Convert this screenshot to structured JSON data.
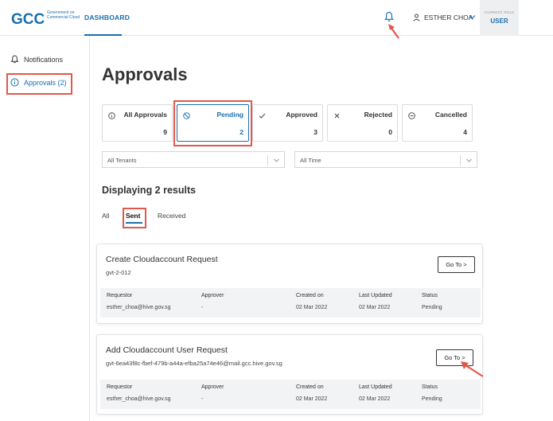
{
  "header": {
    "logo_text": "Government on Commercial Cloud",
    "logo_letters": "GCC",
    "nav_dashboard": "DASHBOARD",
    "user_name": "ESTHER CHOA",
    "role_label": "CURRENT ROLE",
    "role_value": "USER"
  },
  "sidebar": {
    "notifications": "Notifications",
    "approvals": "Approvals (2)"
  },
  "page": {
    "title": "Approvals",
    "results": "Displaying 2 results"
  },
  "stats": [
    {
      "label": "All Approvals",
      "count": "9",
      "icon": "info-icon"
    },
    {
      "label": "Pending",
      "count": "2",
      "icon": "pending-icon"
    },
    {
      "label": "Approved",
      "count": "3",
      "icon": "check-icon"
    },
    {
      "label": "Rejected",
      "count": "0",
      "icon": "x-icon"
    },
    {
      "label": "Cancelled",
      "count": "4",
      "icon": "minus-circle-icon"
    }
  ],
  "filters": {
    "tenants": "All Tenants",
    "time": "All Time"
  },
  "tabs": [
    "All",
    "Sent",
    "Received"
  ],
  "cards": [
    {
      "title": "Create Cloudaccount Request",
      "subtitle": "gvt-2-012",
      "button": "Go To >",
      "headers": [
        "Requestor",
        "Approver",
        "Created on",
        "Last Updated",
        "Status"
      ],
      "values": [
        "esther_choa@hive.gov.sg",
        "-",
        "02 Mar 2022",
        "02 Mar 2022",
        "Pending"
      ]
    },
    {
      "title": "Add Cloudaccount User Request",
      "subtitle": "gvt-6ea43f8c-fbef-479b-a44a-efba25a74e46@mail.gcc.hive.gov.sg",
      "button": "Go To >",
      "headers": [
        "Requestor",
        "Approver",
        "Created on",
        "Last Updated",
        "Status"
      ],
      "values": [
        "esther_choa@hive.gov.sg",
        "-",
        "02 Mar 2022",
        "02 Mar 2022",
        "Pending"
      ]
    }
  ],
  "colors": {
    "accent": "#1a6fae",
    "highlight": "#e2574c"
  }
}
